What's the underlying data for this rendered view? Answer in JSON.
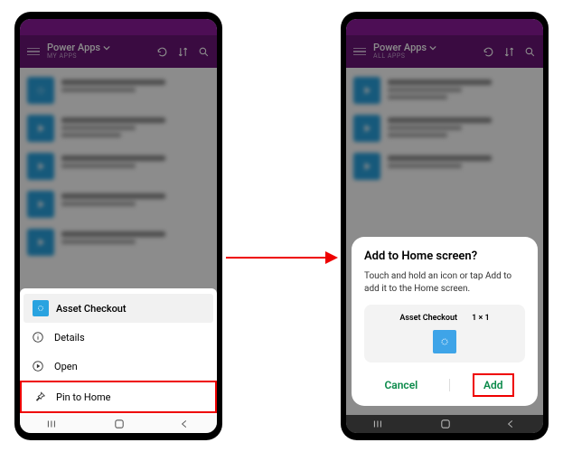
{
  "left": {
    "header": {
      "title": "Power Apps",
      "subtitle": "MY APPS"
    },
    "sheet": {
      "title": "Asset Checkout",
      "rows": [
        {
          "name": "details-row",
          "icon": "info-icon",
          "label": "Details"
        },
        {
          "name": "open-row",
          "icon": "play-icon",
          "label": "Open"
        },
        {
          "name": "pin-row",
          "icon": "pin-icon",
          "label": "Pin to Home",
          "highlight": true
        }
      ]
    }
  },
  "right": {
    "header": {
      "title": "Power Apps",
      "subtitle": "ALL APPS"
    },
    "dialog": {
      "title": "Add to Home screen?",
      "message": "Touch and hold an icon or tap Add to add it to the Home screen.",
      "preview_name": "Asset Checkout",
      "preview_size": "1 × 1",
      "cancel": "Cancel",
      "add": "Add"
    }
  }
}
